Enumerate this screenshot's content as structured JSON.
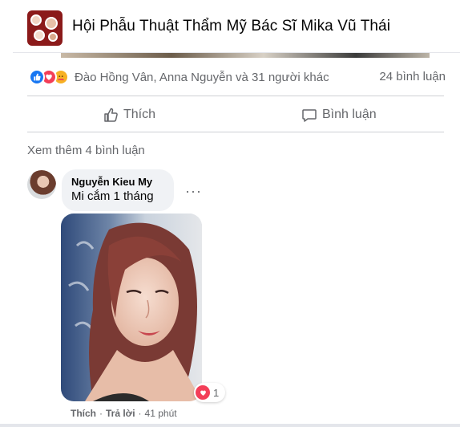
{
  "header": {
    "group_name": "Hội Phẫu Thuật Thẩm Mỹ Bác Sĩ Mika Vũ Thái"
  },
  "reactions": {
    "icons": [
      "like-icon",
      "love-icon",
      "care-icon"
    ],
    "summary": "Đào Hồng Vân, Anna Nguyễn và 31 người khác",
    "comment_count": "24 bình luận"
  },
  "actions": {
    "like_label": "Thích",
    "comment_label": "Bình luận"
  },
  "comments": {
    "view_more": "Xem thêm 4 bình luận",
    "items": [
      {
        "author": "Nguyễn Kieu My",
        "text": "Mi cắm 1 tháng",
        "reaction_count": "1",
        "like_label": "Thích",
        "reply_label": "Trả lời",
        "time": "41 phút"
      }
    ]
  },
  "colors": {
    "accent": "#1877f2",
    "love": "#f33e58",
    "muted_text": "#65676b",
    "bubble_bg": "#f0f2f5"
  }
}
